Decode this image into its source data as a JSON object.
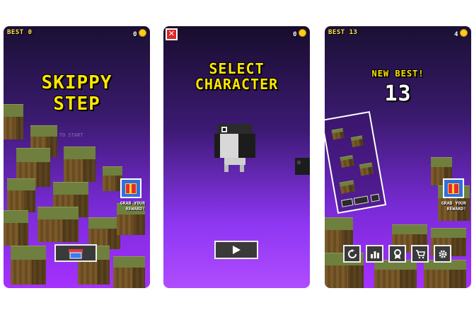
{
  "screens": [
    {
      "hud": {
        "best_label": "BEST",
        "best_value": "0",
        "coins": "0"
      },
      "title_line1": "SKIPPY",
      "title_line2": "STEP",
      "tap_hint": "TAP TO START",
      "reward": {
        "line1": "GRAB YOUR",
        "line2": "REWARD!"
      },
      "bottom_button_icon": "shop-icon"
    },
    {
      "hud": {
        "coins": "0"
      },
      "close_label": "✕",
      "title_line1": "SELECT",
      "title_line2": "CHARACTER",
      "bottom_button_icon": "play-icon"
    },
    {
      "hud": {
        "best_label": "BEST",
        "best_value": "13",
        "coins": "4"
      },
      "new_best_label": "NEW BEST!",
      "score": "13",
      "reward": {
        "line1": "GRAB YOUR",
        "line2": "REWARD!"
      },
      "buttons": [
        "restart-icon",
        "leaderboard-icon",
        "achievements-icon",
        "cart-icon",
        "settings-icon"
      ]
    }
  ],
  "colors": {
    "title": "#ffe600",
    "hud": "#ffe84a",
    "coin": "#ffcc1a",
    "accent_purple": "#a531ff"
  }
}
